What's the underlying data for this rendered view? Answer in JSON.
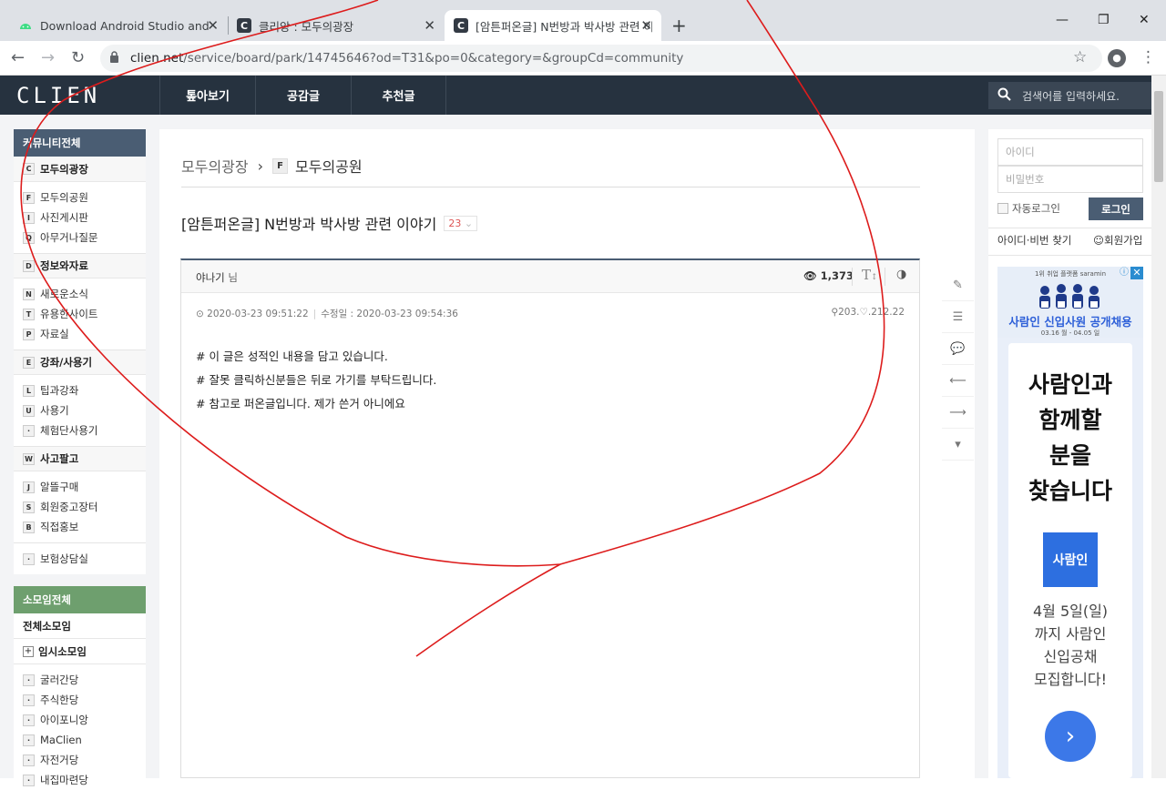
{
  "browser": {
    "tabs": [
      {
        "title": "Download Android Studio and"
      },
      {
        "title": "클리앙 : 모두의광장"
      },
      {
        "title": "[암튼퍼온글] N번방과 박사방 관련 이야기"
      }
    ],
    "url_host": "clien.net",
    "url_path": "/service/board/park/14745646?od=T31&po=0&category=&groupCd=community"
  },
  "site": {
    "logo": "CLIEN",
    "nav": [
      "톺아보기",
      "공감글",
      "추천글"
    ],
    "search_placeholder": "검색어를 입력하세요."
  },
  "left_nav": {
    "community_header": "커뮤니티전체",
    "groups": [
      {
        "badge": "C",
        "label": "모두의광장",
        "items": [
          {
            "badge": "F",
            "label": "모두의공원"
          },
          {
            "badge": "I",
            "label": "사진게시판"
          },
          {
            "badge": "Q",
            "label": "아무거나질문"
          }
        ]
      },
      {
        "badge": "D",
        "label": "정보와자료",
        "items": [
          {
            "badge": "N",
            "label": "새로운소식"
          },
          {
            "badge": "T",
            "label": "유용한사이트"
          },
          {
            "badge": "P",
            "label": "자료실"
          }
        ]
      },
      {
        "badge": "E",
        "label": "강좌/사용기",
        "items": [
          {
            "badge": "L",
            "label": "팁과강좌"
          },
          {
            "badge": "U",
            "label": "사용기"
          },
          {
            "badge": "·",
            "label": "체험단사용기"
          }
        ]
      },
      {
        "badge": "W",
        "label": "사고팔고",
        "items": [
          {
            "badge": "J",
            "label": "알뜰구매"
          },
          {
            "badge": "S",
            "label": "회원중고장터"
          },
          {
            "badge": "B",
            "label": "직접홍보"
          }
        ]
      }
    ],
    "extra_item": {
      "badge": "·",
      "label": "보험상담실"
    },
    "somoim_header": "소모임전체",
    "somoim_all": "전체소모임",
    "somoim_temp": "임시소모임",
    "somoim_items": [
      "굴러간당",
      "주식한당",
      "아이포니앙",
      "MaClien",
      "자전거당",
      "내집마련당"
    ]
  },
  "post": {
    "breadcrumb_parent": "모두의광장",
    "breadcrumb_badge": "F",
    "breadcrumb_current": "모두의공원",
    "title": "[암튼퍼온글] N번방과 박사방 관련 이야기",
    "comment_count": "23",
    "author": "야나기",
    "author_suffix": "님",
    "views": "1,373",
    "font_icon_label": "T",
    "date": "2020-03-23 09:51:22",
    "modified": "수정일 : 2020-03-23 09:54:36",
    "ip": "203.♡.212.22",
    "body": [
      "# 이 글은 성적인 내용을 담고 있습니다.",
      "# 잘못 클릭하신분들은 뒤로 가기를 부탁드립니다.",
      "# 참고로 퍼온글입니다. 제가 쓴거 아니에요"
    ]
  },
  "login": {
    "id_placeholder": "아이디",
    "pw_placeholder": "비밀번호",
    "auto_login": "자동로그인",
    "login_button": "로그인",
    "find": "아이디·비번 찾기",
    "signup": "회원가입"
  },
  "ad": {
    "small": "1위 취업 플랫폼 saramin",
    "banner": "사람인 신입사원 공개채용",
    "dates": "03.16 월 - 04.05 일",
    "headline": [
      "사람인과",
      "함께할",
      "분을",
      "찾습니다"
    ],
    "logo": "사람인",
    "body": [
      "4월 5일(일)",
      "까지 사람인",
      "신입공채",
      "모집합니다!"
    ]
  },
  "colors": {
    "header_bg": "#26323f",
    "nav_blue": "#4a5d73",
    "nav_green": "#6e9f6e",
    "scribble": "#dd1c1c"
  }
}
